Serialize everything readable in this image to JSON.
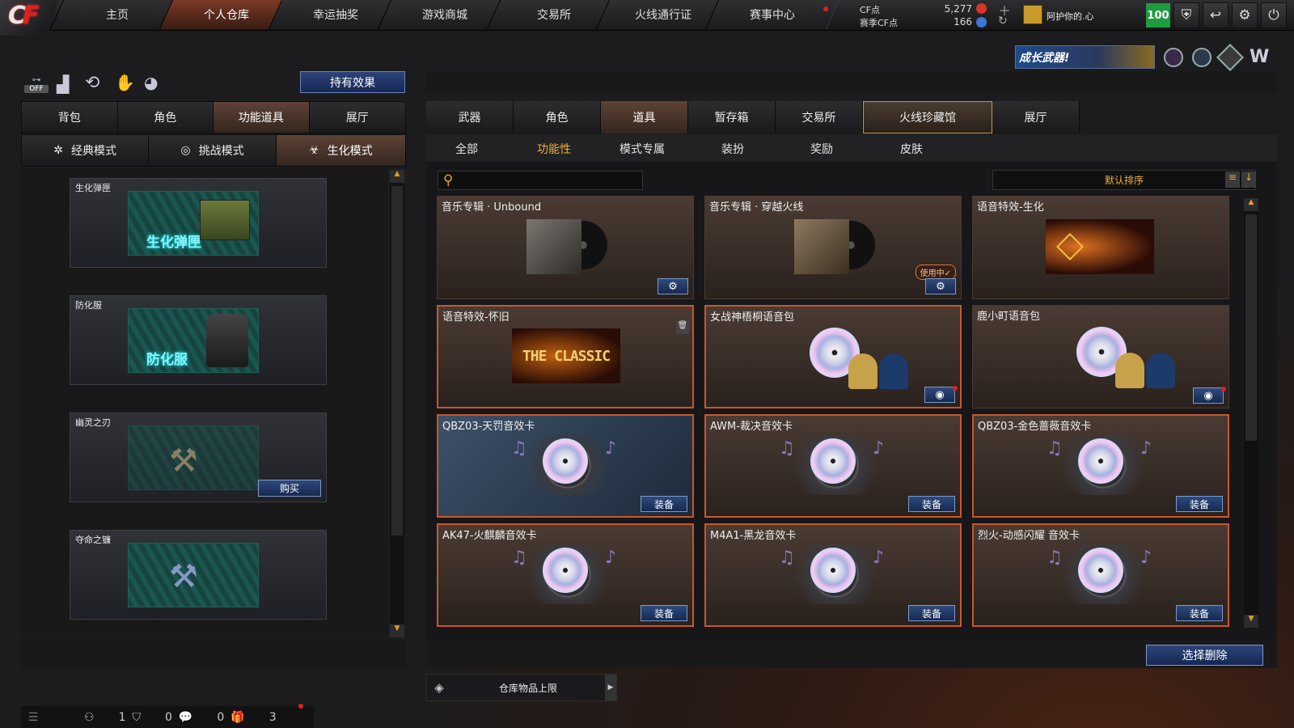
{
  "nav": {
    "tabs": [
      {
        "label": "主页"
      },
      {
        "label": "个人仓库"
      },
      {
        "label": "幸运抽奖"
      },
      {
        "label": "游戏商城"
      },
      {
        "label": "交易所"
      },
      {
        "label": "火线通行证"
      },
      {
        "label": "赛事中心"
      }
    ],
    "active_index": 1,
    "currency": {
      "cf_label": "CF点",
      "cf_value": "5,277",
      "season_label": "赛季CF点",
      "season_value": "166"
    },
    "username": "阿护你的.心",
    "level": "100"
  },
  "banner": {
    "text": "成长武器!"
  },
  "left": {
    "effects_button": "持有效果",
    "off_label": "OFF",
    "tabs": [
      {
        "label": "背包"
      },
      {
        "label": "角色"
      },
      {
        "label": "功能道具"
      },
      {
        "label": "展厅"
      }
    ],
    "modes": [
      {
        "label": "经典模式"
      },
      {
        "label": "挑战模式"
      },
      {
        "label": "生化模式"
      }
    ],
    "cards": [
      {
        "title": "生化弹匣",
        "art": "生化弹匣"
      },
      {
        "title": "防化服",
        "art": "防化服"
      },
      {
        "title": "幽灵之刃",
        "buy": "购买"
      },
      {
        "title": "夺命之镰"
      }
    ]
  },
  "right": {
    "tabs": [
      {
        "label": "武器"
      },
      {
        "label": "角色"
      },
      {
        "label": "道具"
      },
      {
        "label": "暂存箱"
      },
      {
        "label": "交易所"
      },
      {
        "label": "火线珍藏馆"
      },
      {
        "label": "展厅"
      }
    ],
    "subtabs": [
      {
        "label": "全部"
      },
      {
        "label": "功能性"
      },
      {
        "label": "模式专属"
      },
      {
        "label": "装扮"
      },
      {
        "label": "奖励"
      },
      {
        "label": "皮肤"
      }
    ],
    "sort_label": "默认排序",
    "search_placeholder": "",
    "items": [
      {
        "title": "音乐专辑 · Unbound"
      },
      {
        "title": "音乐专辑 · 穿越火线",
        "badge": "使用中✓"
      },
      {
        "title": "语音特效-生化"
      },
      {
        "title": "语音特效-怀旧",
        "art_text": "THE CLASSIC"
      },
      {
        "title": "女战神梧桐语音包"
      },
      {
        "title": "鹿小町语音包"
      },
      {
        "title": "QBZ03-天罚音效卡",
        "button": "装备"
      },
      {
        "title": "AWM-裁决音效卡",
        "button": "装备"
      },
      {
        "title": "QBZ03-金色蔷薇音效卡",
        "button": "装备"
      },
      {
        "title": "AK47-火麒麟音效卡",
        "button": "装备"
      },
      {
        "title": "M4A1-黑龙音效卡",
        "button": "装备"
      },
      {
        "title": "烈火-动感闪耀 音效卡",
        "button": "装备"
      }
    ],
    "delete_button": "选择删除",
    "storage_label": "仓库物品上限"
  },
  "footer": {
    "counts": [
      "1",
      "0",
      "0",
      "3"
    ]
  },
  "colors": {
    "accent": "#c8572c",
    "gold": "#f0b030",
    "blue_button": "#2f4a7d",
    "green_level": "#27a34a"
  }
}
